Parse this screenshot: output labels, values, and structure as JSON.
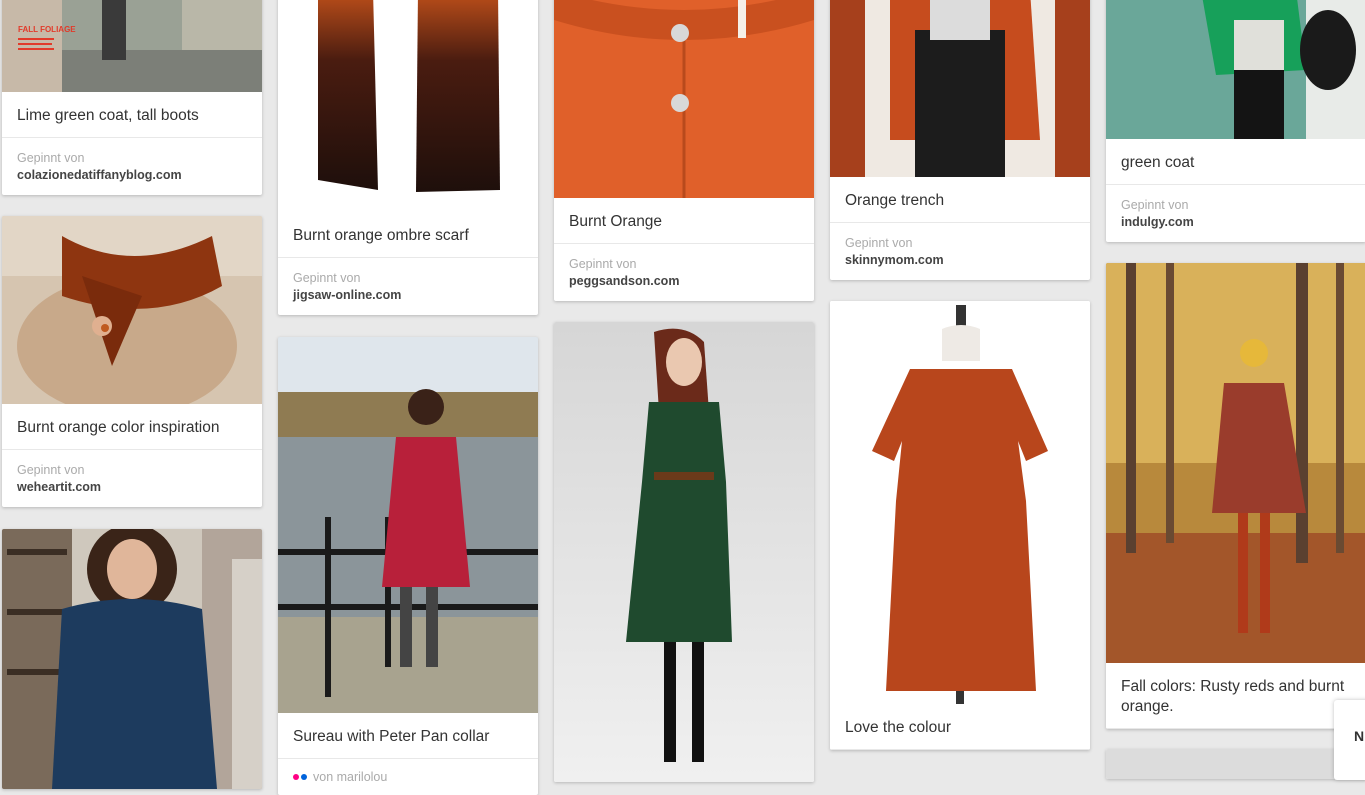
{
  "source_label": "Gepinnt von",
  "pins": [
    {
      "id": "lime-green-coat",
      "description": "Lime green coat, tall boots",
      "domain": "colazionedatiffanyblog.com",
      "image_caption": "FALL FOLIAGE"
    },
    {
      "id": "burnt-orange-color",
      "description": "Burnt orange color inspiration",
      "domain": "weheartit.com"
    },
    {
      "id": "navy-dress",
      "description": ""
    },
    {
      "id": "ombre-scarf",
      "description": "Burnt orange ombre scarf",
      "domain": "jigsaw-online.com"
    },
    {
      "id": "peter-pan",
      "description": "Sureau with Peter Pan collar",
      "via": "von marilolou"
    },
    {
      "id": "burnt-orange",
      "description": "Burnt Orange",
      "domain": "peggsandson.com"
    },
    {
      "id": "green-dress",
      "description": ""
    },
    {
      "id": "orange-trench",
      "description": "Orange trench",
      "domain": "skinnymom.com"
    },
    {
      "id": "love-colour",
      "description": "Love the colour"
    },
    {
      "id": "green-coat",
      "description": "green coat",
      "domain": "indulgy.com"
    },
    {
      "id": "fall-colors",
      "description": "Fall colors: Rusty reds and burnt orange."
    }
  ],
  "help_box": {
    "text": "N o"
  },
  "colors": {
    "background": "#e9e9e9",
    "card": "#ffffff",
    "source_label": "#aaaaaa",
    "domain": "#444444"
  }
}
